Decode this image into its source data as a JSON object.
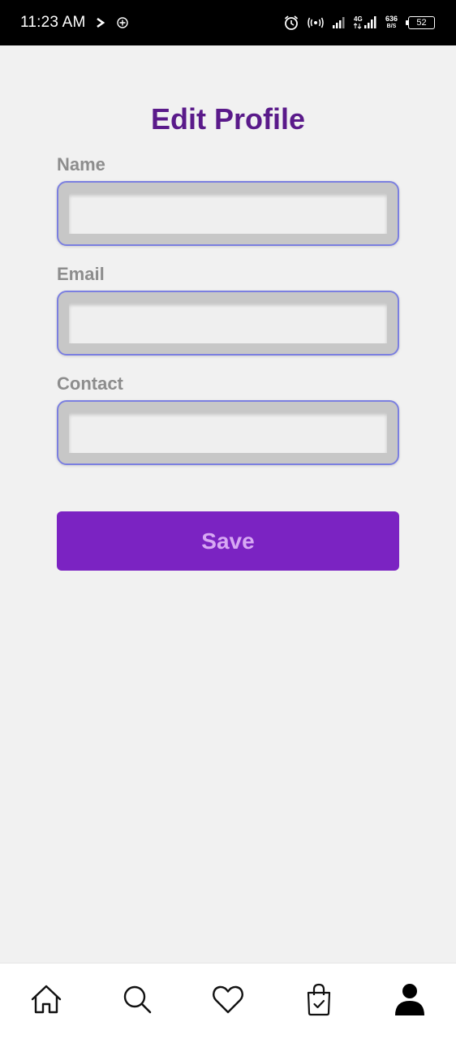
{
  "status_bar": {
    "time": "11:23 AM",
    "net_speed_value": "636",
    "net_speed_unit": "B/S",
    "network_type": "4G",
    "battery": "52"
  },
  "page": {
    "title": "Edit Profile"
  },
  "form": {
    "fields": [
      {
        "label": "Name",
        "value": ""
      },
      {
        "label": "Email",
        "value": ""
      },
      {
        "label": "Contact",
        "value": ""
      }
    ],
    "save_label": "Save"
  },
  "bottom_nav": {
    "items": [
      {
        "icon": "home-icon"
      },
      {
        "icon": "search-icon"
      },
      {
        "icon": "heart-icon"
      },
      {
        "icon": "shopping-bag-icon"
      },
      {
        "icon": "profile-icon",
        "active": true
      }
    ]
  },
  "colors": {
    "title": "#5a1a8a",
    "label": "#8d8d8d",
    "field_border": "#7b7fe0",
    "button_bg": "#7b23c2",
    "button_text": "#d7a9f3",
    "background": "#f1f1f1"
  }
}
